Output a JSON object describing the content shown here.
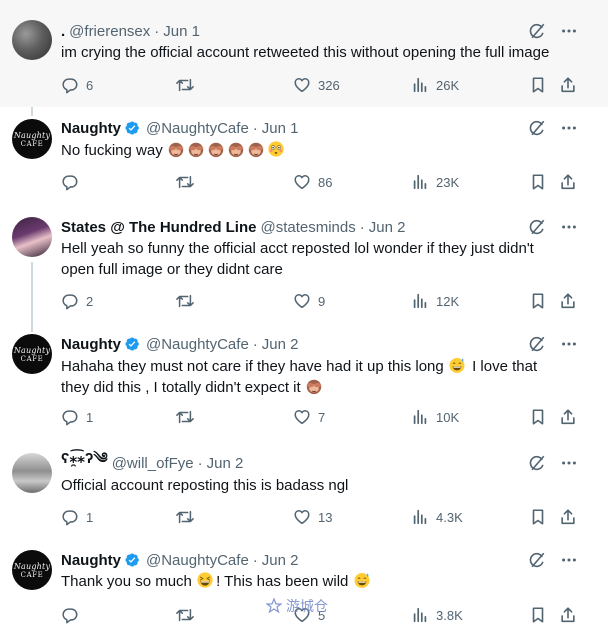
{
  "tweets": [
    {
      "display_name": ".",
      "handle": "@frierensex",
      "date": "Jun 1",
      "verified": false,
      "text_lines": [
        "im crying the official account retweeted this without opening the full image"
      ],
      "replies": "6",
      "reposts": "",
      "likes": "326",
      "views": "26K"
    },
    {
      "display_name": "Naughty",
      "handle": "@NaughtyCafe",
      "date": "Jun 1",
      "verified": true,
      "text_lines": [
        "No fucking way"
      ],
      "emoji": [
        "see-no-evil-monkey",
        "see-no-evil-monkey",
        "see-no-evil-monkey",
        "see-no-evil-monkey",
        "see-no-evil-monkey",
        "flushed-face"
      ],
      "replies": "",
      "reposts": "",
      "likes": "86",
      "views": "23K"
    },
    {
      "display_name": "States @ The Hundred Line",
      "handle": "@statesminds",
      "date": "Jun 2",
      "verified": false,
      "text_lines": [
        "Hell yeah so funny the official acct reposted lol wonder if they just didn't",
        "open full image or they didnt care"
      ],
      "replies": "2",
      "reposts": "",
      "likes": "9",
      "views": "12K"
    },
    {
      "display_name": "Naughty",
      "handle": "@NaughtyCafe",
      "date": "Jun 2",
      "verified": true,
      "text_lines": [
        "Hahaha they must not care if they have had it up this long",
        "I love that",
        "they did this , I totally didn't expect it"
      ],
      "emoji": [
        "grinning-sweat-face",
        "see-no-evil-monkey"
      ],
      "replies": "1",
      "reposts": "",
      "likes": "7",
      "views": "10K"
    },
    {
      "display_name": "ʕ⁎̯͡⁎ʔ༄",
      "handle": "@will_ofFye",
      "date": "Jun 2",
      "verified": false,
      "text_lines": [
        "Official account reposting this is badass ngl"
      ],
      "replies": "1",
      "reposts": "",
      "likes": "13",
      "views": "4.3K"
    },
    {
      "display_name": "Naughty",
      "handle": "@NaughtyCafe",
      "date": "Jun 2",
      "verified": true,
      "text_lines": [
        "Thank you so much",
        "! This has been wild"
      ],
      "emoji": [
        "grinning-squinting-face",
        "grinning-sweat-face"
      ],
      "replies": "",
      "reposts": "",
      "likes": "5",
      "views": "3.8K"
    }
  ],
  "avatar": {
    "naughty_top": "Naughty",
    "naughty_bottom": "CAFE"
  },
  "watermark": {
    "text": "游城仓"
  },
  "icons": {
    "top_right": [
      "grok-icon",
      "more-icon"
    ],
    "actions": [
      "reply-icon",
      "repost-icon",
      "like-icon",
      "views-icon",
      "bookmark-icon",
      "share-icon"
    ]
  },
  "colors": {
    "text": "#0f1419",
    "muted": "#536471",
    "verified": "#1d9bf0",
    "shaded_row": "#f7f7f7",
    "thread_line": "#cfd9de"
  }
}
